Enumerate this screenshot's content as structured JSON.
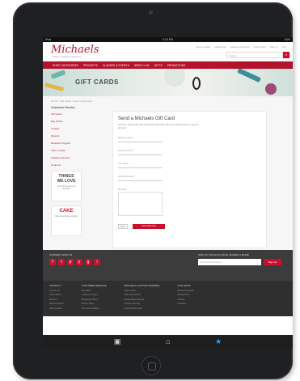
{
  "statusbar": {
    "carrier": "iPad",
    "time": "3:23 PM",
    "battery": "94%"
  },
  "header": {
    "logo": "Michaels",
    "tagline": "Where Creativity Happens",
    "links": [
      "Store Locator",
      "Weekly Ad",
      "Classes & Events",
      "Track Order",
      "Sign In",
      "Cart"
    ],
    "search_placeholder": "Search"
  },
  "nav": {
    "items": [
      "Shop Categories",
      "Projects",
      "Classes & Events",
      "Weekly Ad",
      "Gifts",
      "Promotions"
    ]
  },
  "banner": {
    "title": "GIFT CARDS"
  },
  "breadcrumb": "Home > Gift Cards > Send a Gift Card",
  "sidebar": {
    "heading": "Customer Service",
    "items": [
      "Gift Cards",
      "Buy Online",
      "Contact",
      "Returns",
      "Rewards Program",
      "Store Locator",
      "Classes & Events",
      "Coupons"
    ],
    "promo1": {
      "line1": "THINGS",
      "line2": "WE LOVE",
      "sub": "Fresh finds and new favorites"
    },
    "promo2": {
      "line1": "CAKE",
      "sub": "Cake decorating supplies"
    }
  },
  "form": {
    "title": "Send a Michaels Gift Card",
    "description": "Send the perfect gift with a Michaels Gift Card. Fill in the details below to send a gift card.",
    "fields": [
      "Recipient Name",
      "Recipient Email",
      "Your Name",
      "Gift Card Amount",
      "Message"
    ],
    "cancel_label": "Back",
    "submit_label": "Send Gift Card"
  },
  "footer": {
    "connect_label": "Connect With Us",
    "social": [
      "f",
      "t",
      "p",
      "y",
      "g",
      "i"
    ],
    "newsletter_label": "Sign Up For Exclusive Offers & More",
    "newsletter_placeholder": "Enter Email Address",
    "newsletter_button": "Sign Up",
    "columns": [
      {
        "heading": "Contact",
        "links": [
          "Contact Us",
          "Order Status",
          "Returns",
          "Help & Support",
          "Store Locator"
        ]
      },
      {
        "heading": "Customer Service",
        "links": [
          "Gift Cards",
          "Coupons & Sales",
          "Shipping & Policy",
          "Privacy Policy",
          "Terms & Conditions"
        ]
      },
      {
        "heading": "Michaels Custom Framing",
        "links": [
          "Frame Shop",
          "Framing Services",
          "Ready-Made Frames",
          "Custom Framing",
          "Framing Gift Cards"
        ]
      },
      {
        "heading": "Our Sites",
        "links": [
          "Michaels Canada",
          "Michaels Pro",
          "Careers",
          "Investors"
        ]
      }
    ]
  },
  "tabbar": {
    "icons": [
      "camera-icon",
      "home-icon",
      "favorites-star-icon"
    ]
  }
}
